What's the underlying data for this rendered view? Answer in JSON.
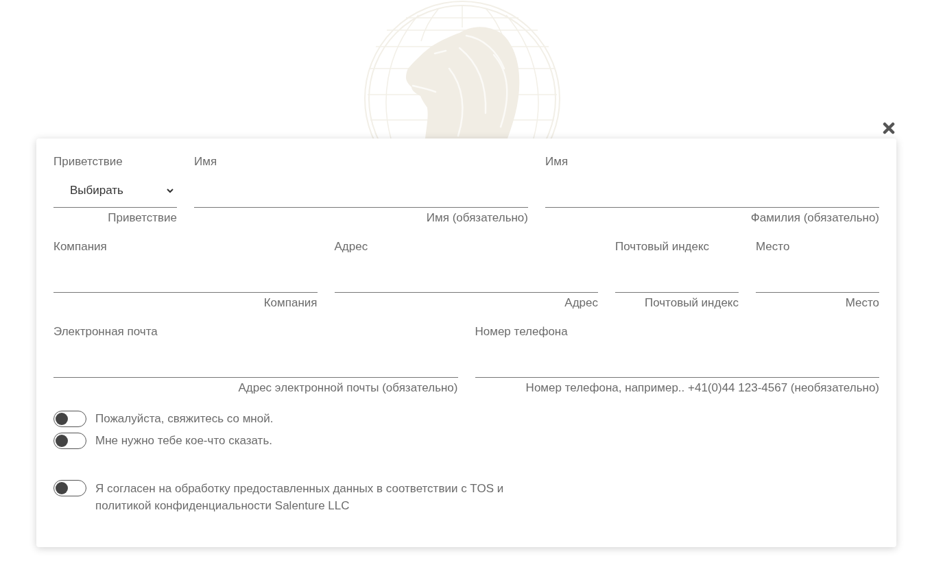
{
  "form": {
    "rows": [
      {
        "fields": [
          {
            "kind": "select",
            "label": "Приветствие",
            "value": "Выбирать",
            "helper": "Приветствие"
          },
          {
            "kind": "text",
            "label": "Имя",
            "helper": "Имя (обязательно)"
          },
          {
            "kind": "text",
            "label": "Имя",
            "helper": "Фамилия (обязательно)"
          }
        ]
      },
      {
        "fields": [
          {
            "kind": "text",
            "label": "Компания",
            "helper": "Компания"
          },
          {
            "kind": "text",
            "label": "Адрес",
            "helper": "Адрес"
          },
          {
            "kind": "text",
            "label": "Почтовый индекс",
            "helper": "Почтовый индекс"
          },
          {
            "kind": "text",
            "label": "Место",
            "helper": "Место"
          }
        ]
      },
      {
        "fields": [
          {
            "kind": "text",
            "label": "Электронная почта",
            "helper": "Адрес электронной почты (обязательно)"
          },
          {
            "kind": "text",
            "label": "Номер телефона",
            "helper": "Номер телефона, например.. +41(0)44 123-4567 (необязательно)"
          }
        ]
      }
    ],
    "options": [
      {
        "label": "Пожалуйста, свяжитесь со мной.",
        "on": false
      },
      {
        "label": "Мне нужно тебе кое-что сказать.",
        "on": false
      }
    ],
    "consent": {
      "label": "Я согласен на обработку предоставленных данных в соответствии с TOS и политикой конфиденциальности Salenture LLC",
      "on": false
    }
  }
}
